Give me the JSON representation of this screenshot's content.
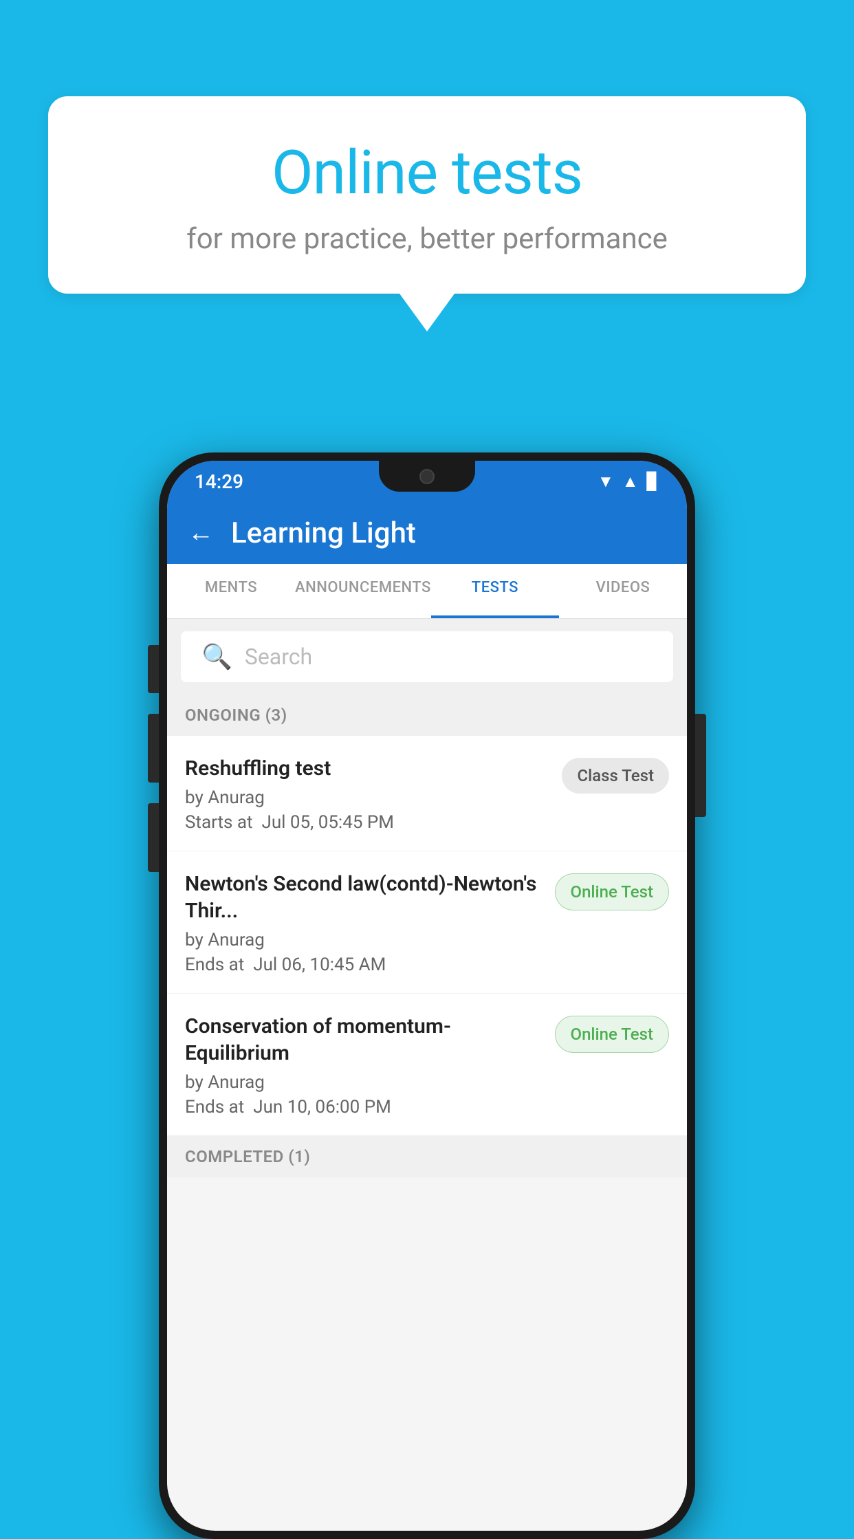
{
  "background": {
    "color": "#1ab8e8"
  },
  "speech_bubble": {
    "title": "Online tests",
    "subtitle": "for more practice, better performance"
  },
  "status_bar": {
    "time": "14:29",
    "icons": [
      "wifi",
      "signal",
      "battery"
    ]
  },
  "app_bar": {
    "back_label": "←",
    "title": "Learning Light"
  },
  "tabs": [
    {
      "label": "MENTS",
      "active": false
    },
    {
      "label": "ANNOUNCEMENTS",
      "active": false
    },
    {
      "label": "TESTS",
      "active": true
    },
    {
      "label": "VIDEOS",
      "active": false
    }
  ],
  "search": {
    "placeholder": "Search"
  },
  "ongoing_section": {
    "label": "ONGOING (3)"
  },
  "test_items": [
    {
      "name": "Reshuffling test",
      "author": "by Anurag",
      "date_label": "Starts at",
      "date": "Jul 05, 05:45 PM",
      "badge": "Class Test",
      "badge_type": "class"
    },
    {
      "name": "Newton's Second law(contd)-Newton's Thir...",
      "author": "by Anurag",
      "date_label": "Ends at",
      "date": "Jul 06, 10:45 AM",
      "badge": "Online Test",
      "badge_type": "online"
    },
    {
      "name": "Conservation of momentum-Equilibrium",
      "author": "by Anurag",
      "date_label": "Ends at",
      "date": "Jun 10, 06:00 PM",
      "badge": "Online Test",
      "badge_type": "online"
    }
  ],
  "completed_section": {
    "label": "COMPLETED (1)"
  }
}
